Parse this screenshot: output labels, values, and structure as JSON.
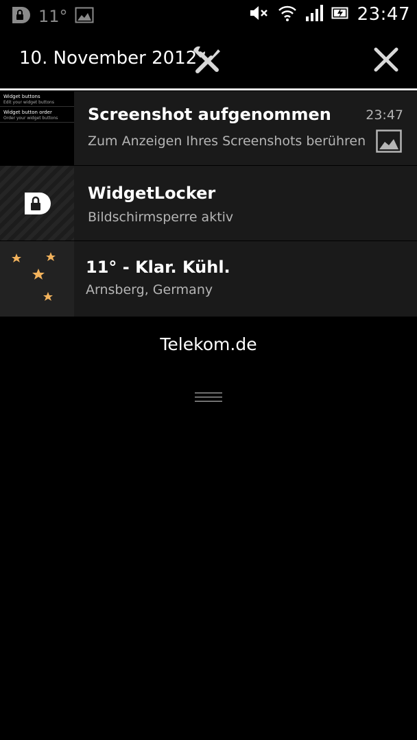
{
  "status_bar": {
    "temperature": "11°",
    "time": "23:47",
    "icons": [
      "widgetlocker-icon",
      "image-icon",
      "mute-icon",
      "wifi-icon",
      "signal-icon",
      "battery-icon"
    ]
  },
  "header": {
    "date": "10. November 2012",
    "settings_icon": "tools-icon",
    "close_icon": "close-icon"
  },
  "notifications": [
    {
      "title": "Screenshot aufgenommen",
      "subtitle": "Zum Anzeigen Ihres Screenshots berühren",
      "time": "23:47",
      "thumbnail": {
        "rows": [
          {
            "title": "Widget buttons",
            "sub": "Edit your widget buttons"
          },
          {
            "title": "Widget button order",
            "sub": "Order your widget buttons"
          }
        ]
      }
    },
    {
      "title": "WidgetLocker",
      "subtitle": "Bildschirmsperre aktiv"
    },
    {
      "title": "11° - Klar. Kühl.",
      "subtitle": "Arnsberg, Germany"
    }
  ],
  "carrier": "Telekom.de",
  "colors": {
    "background": "#000000",
    "notification_bg": "#1a1a1a",
    "subtitle": "#b5b5b5",
    "star": "#f2b25c",
    "moon": "#6b6b6b"
  }
}
